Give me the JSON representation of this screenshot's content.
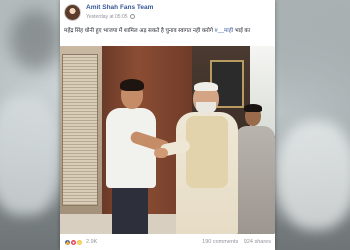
{
  "post": {
    "page_name": "Amit Shah Fans Team",
    "timestamp": "Yesterday at 05:05",
    "text": "महेंद्र सिंह धोनी हुए भाजपा में शामिल अड़ सकते है चुनाव स्वागत नही करोगे",
    "hashtag": "#__माही",
    "text_end": "भाई का"
  },
  "footer": {
    "reaction_count": "2.9K",
    "comments": "190 comments",
    "shares": "924 shares"
  },
  "colors": {
    "link": "#385898",
    "meta": "#90949c",
    "like": "#4267b2",
    "love": "#ed4a5e",
    "haha": "#f7c744"
  },
  "icons": [
    "globe-icon",
    "like-icon",
    "love-icon",
    "haha-icon"
  ]
}
